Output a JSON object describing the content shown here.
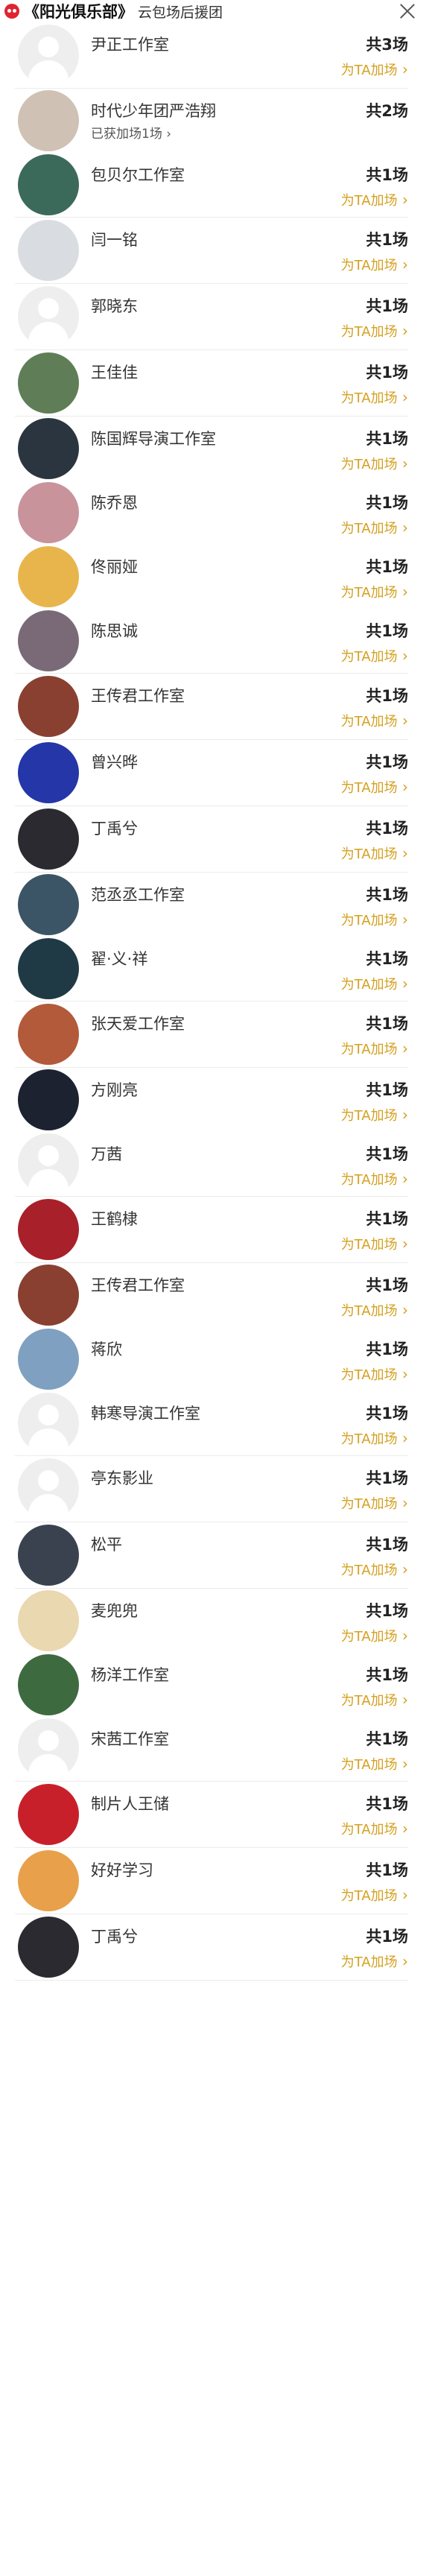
{
  "header": {
    "title": "《阳光俱乐部》",
    "subtitle": "云包场后援团"
  },
  "groups": [
    {
      "items": [
        {
          "name": "尹正工作室",
          "total": "共3场",
          "action": "为TA加场",
          "avatar": "#eeeeee",
          "placeholder": true
        }
      ]
    },
    {
      "items": [
        {
          "name": "时代少年团严浩翔",
          "sub": "已获加场1场 ›",
          "total": "共2场",
          "action": "",
          "avatar": "#cfc2b4"
        },
        {
          "name": "包贝尔工作室",
          "total": "共1场",
          "action": "为TA加场",
          "avatar": "#3c6a5a"
        }
      ]
    },
    {
      "items": [
        {
          "name": "闫一铭",
          "total": "共1场",
          "action": "为TA加场",
          "avatar": "#d9dde2"
        }
      ]
    },
    {
      "items": [
        {
          "name": "郭晓东",
          "total": "共1场",
          "action": "为TA加场",
          "avatar": "#eeeeee",
          "placeholder": true
        }
      ]
    },
    {
      "items": [
        {
          "name": "王佳佳",
          "total": "共1场",
          "action": "为TA加场",
          "avatar": "#5f7e57"
        }
      ]
    },
    {
      "items": [
        {
          "name": "陈国辉导演工作室",
          "total": "共1场",
          "action": "为TA加场",
          "avatar": "#2b3540"
        },
        {
          "name": "陈乔恩",
          "total": "共1场",
          "action": "为TA加场",
          "avatar": "#c9939c"
        },
        {
          "name": "佟丽娅",
          "total": "共1场",
          "action": "为TA加场",
          "avatar": "#e8b54c"
        },
        {
          "name": "陈思诚",
          "total": "共1场",
          "action": "为TA加场",
          "avatar": "#7a6a78"
        }
      ]
    },
    {
      "items": [
        {
          "name": "王传君工作室",
          "total": "共1场",
          "action": "为TA加场",
          "avatar": "#8a4030"
        }
      ]
    },
    {
      "items": [
        {
          "name": "曾兴晔",
          "total": "共1场",
          "action": "为TA加场",
          "avatar": "#2436a8"
        }
      ]
    },
    {
      "items": [
        {
          "name": "丁禹兮",
          "total": "共1场",
          "action": "为TA加场",
          "avatar": "#2a2a30"
        }
      ]
    },
    {
      "items": [
        {
          "name": "范丞丞工作室",
          "total": "共1场",
          "action": "为TA加场",
          "avatar": "#3b5566"
        },
        {
          "name": "翟·义·祥",
          "total": "共1场",
          "action": "为TA加场",
          "avatar": "#1f3a44"
        }
      ]
    },
    {
      "items": [
        {
          "name": "张天爱工作室",
          "total": "共1场",
          "action": "为TA加场",
          "avatar": "#b35a3a"
        }
      ]
    },
    {
      "items": [
        {
          "name": "方刚亮",
          "total": "共1场",
          "action": "为TA加场",
          "avatar": "#1c2230"
        },
        {
          "name": "万茜",
          "total": "共1场",
          "action": "为TA加场",
          "avatar": "#eeeeee",
          "placeholder": true
        }
      ]
    },
    {
      "items": [
        {
          "name": "王鹤棣",
          "total": "共1场",
          "action": "为TA加场",
          "avatar": "#a8202a"
        }
      ]
    },
    {
      "items": [
        {
          "name": "王传君工作室",
          "total": "共1场",
          "action": "为TA加场",
          "avatar": "#8a4030"
        },
        {
          "name": "蒋欣",
          "total": "共1场",
          "action": "为TA加场",
          "avatar": "#7fa0c0"
        },
        {
          "name": "韩寒导演工作室",
          "total": "共1场",
          "action": "为TA加场",
          "avatar": "#eeeeee",
          "placeholder": true
        }
      ]
    },
    {
      "items": [
        {
          "name": "亭东影业",
          "total": "共1场",
          "action": "为TA加场",
          "avatar": "#eeeeee",
          "placeholder": true
        }
      ]
    },
    {
      "items": [
        {
          "name": "松平",
          "total": "共1场",
          "action": "为TA加场",
          "avatar": "#3a4250"
        }
      ]
    },
    {
      "items": [
        {
          "name": "麦兜兜",
          "total": "共1场",
          "action": "为TA加场",
          "avatar": "#e9d8b0"
        },
        {
          "name": "杨洋工作室",
          "total": "共1场",
          "action": "为TA加场",
          "avatar": "#3e6a40"
        },
        {
          "name": "宋茜工作室",
          "total": "共1场",
          "action": "为TA加场",
          "avatar": "#eeeeee",
          "placeholder": true
        }
      ]
    },
    {
      "items": [
        {
          "name": "制片人王储",
          "total": "共1场",
          "action": "为TA加场",
          "avatar": "#c8202a"
        }
      ]
    },
    {
      "items": [
        {
          "name": "好好学习",
          "total": "共1场",
          "action": "为TA加场",
          "avatar": "#e8a04a"
        }
      ]
    },
    {
      "items": [
        {
          "name": "丁禹兮",
          "total": "共1场",
          "action": "为TA加场",
          "avatar": "#2a2a30"
        }
      ]
    }
  ]
}
